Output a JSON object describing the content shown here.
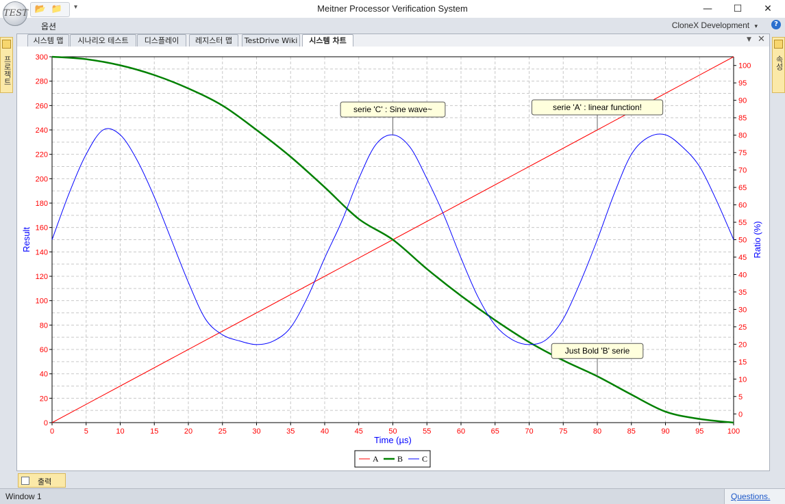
{
  "window": {
    "title": "Meitner Processor Verification System",
    "logo_text": "TEST",
    "minimize_glyph": "—",
    "maximize_glyph": "☐",
    "close_glyph": "✕"
  },
  "quick_access": {
    "items": [
      "folder-open-icon",
      "folder-icon"
    ],
    "more_glyph": "▾"
  },
  "menubar": {
    "options_label": "옵션",
    "right_label": "CloneX Development",
    "right_arrow": "▾",
    "help_glyph": "?"
  },
  "side_tabs": {
    "left_label": "프로젝트",
    "right_label": "속성"
  },
  "tabs": [
    {
      "label": "시스템 맵",
      "active": false
    },
    {
      "label": "시나리오 테스트",
      "active": false
    },
    {
      "label": "디스플레이",
      "active": false
    },
    {
      "label": "레지스터 맵",
      "active": false
    },
    {
      "label": "TestDrive Wiki",
      "active": false
    },
    {
      "label": "시스템 차트",
      "active": true
    }
  ],
  "tab_controls": {
    "menu_glyph": "▼",
    "close_glyph": "✕"
  },
  "output_tab": {
    "label": "출력"
  },
  "status": {
    "left": "Window 1",
    "right": "Questions."
  },
  "colors": {
    "A": "#ff0000",
    "B": "#008000",
    "C": "#0000ff",
    "axis_left": "#0000ff",
    "tick_text": "#ff0000"
  },
  "chart_data": {
    "type": "line",
    "xlabel": "Time (µs)",
    "ylabel": "Result",
    "y2label": "Ratio (%)",
    "xlim": [
      0,
      100
    ],
    "ylim": [
      0,
      300
    ],
    "y2lim": [
      -2.5,
      102.5
    ],
    "x_ticks": [
      0,
      5,
      10,
      15,
      20,
      25,
      30,
      35,
      40,
      45,
      50,
      55,
      60,
      65,
      70,
      75,
      80,
      85,
      90,
      95,
      100
    ],
    "y_ticks": [
      0,
      20,
      40,
      60,
      80,
      100,
      120,
      140,
      160,
      180,
      200,
      220,
      240,
      260,
      280,
      300
    ],
    "y2_ticks": [
      0,
      5,
      10,
      15,
      20,
      25,
      30,
      35,
      40,
      45,
      50,
      55,
      60,
      65,
      70,
      75,
      80,
      85,
      90,
      95,
      100
    ],
    "grid": true,
    "legend_position": "bottom-center",
    "series": [
      {
        "name": "A",
        "color": "#ff0000",
        "width": 1,
        "x": [
          0,
          10,
          20,
          30,
          40,
          50,
          60,
          70,
          80,
          90,
          100
        ],
        "y": [
          0,
          30,
          60,
          90,
          120,
          150,
          180,
          210,
          240,
          270,
          300
        ]
      },
      {
        "name": "B",
        "color": "#008000",
        "width": 2.5,
        "x": [
          0,
          5,
          10,
          15,
          20,
          25,
          30,
          35,
          40,
          45,
          50,
          55,
          60,
          65,
          70,
          75,
          80,
          85,
          90,
          95,
          100
        ],
        "y": [
          300,
          298,
          293,
          285,
          274,
          260,
          240,
          218,
          193,
          167,
          150,
          126,
          104,
          84,
          66,
          51,
          38,
          23,
          9,
          3,
          0
        ]
      },
      {
        "name": "C",
        "color": "#0000ff",
        "width": 1,
        "x": [
          0,
          2.5,
          5,
          7.5,
          10,
          12.5,
          15,
          17.5,
          20,
          22.5,
          25,
          27.5,
          30,
          32.5,
          35,
          37.5,
          40,
          42.5,
          45,
          47.5,
          50,
          52.5,
          55,
          57.5,
          60,
          62.5,
          65,
          67.5,
          70,
          72.5,
          75,
          77.5,
          80,
          82.5,
          85,
          87.5,
          90,
          92.5,
          95,
          97.5,
          100
        ],
        "y": [
          150,
          188,
          220,
          240,
          236,
          215,
          185,
          150,
          115,
          85,
          72,
          67,
          64,
          67,
          78,
          103,
          135,
          165,
          200,
          228,
          236,
          226,
          200,
          170,
          135,
          103,
          80,
          68,
          64,
          68,
          85,
          115,
          150,
          188,
          220,
          234,
          236,
          226,
          210,
          182,
          150
        ]
      }
    ],
    "annotations": [
      {
        "text": "serie 'C' : Sine wave~",
        "x": 50,
        "y": 236
      },
      {
        "text": "serie 'A' : linear function!",
        "x": 80,
        "y": 240
      },
      {
        "text": "Just Bold 'B' serie",
        "x": 80,
        "y": 38
      }
    ]
  }
}
